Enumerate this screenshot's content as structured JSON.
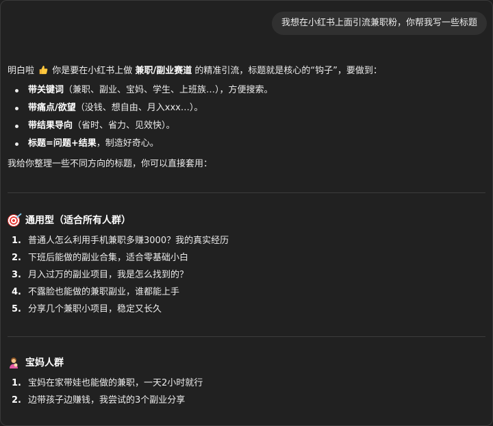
{
  "user_message": "我想在小红书上面引流兼职粉，你帮我写一些标题",
  "assistant": {
    "intro": {
      "p1": "明白啦",
      "p2": "你是要在小红书上做",
      "p3": "兼职/副业赛道",
      "p4": "的精准引流，标题就是核心的“钩子”，要做到："
    },
    "bullets": [
      {
        "bold": "带关键词",
        "rest": "（兼职、副业、宝妈、学生、上班族…），方便搜索。"
      },
      {
        "bold": "带痛点/欲望",
        "rest": "（没钱、想自由、月入xxx…）。"
      },
      {
        "bold": "带结果导向",
        "rest": "（省时、省力、见效快）。"
      },
      {
        "bold": "标题=问题+结果",
        "rest": "，制造好奇心。"
      }
    ],
    "intro2": "我给你整理一些不同方向的标题，你可以直接套用："
  },
  "sections": [
    {
      "icon": "target-icon",
      "title": "通用型（适合所有人群）",
      "items": [
        {
          "num": "1.",
          "text": "普通人怎么利用手机兼职多赚3000？我的真实经历"
        },
        {
          "num": "2.",
          "text": "下班后能做的副业合集，适合零基础小白"
        },
        {
          "num": "3.",
          "text": "月入过万的副业项目，我是怎么找到的？"
        },
        {
          "num": "4.",
          "text": "不露脸也能做的兼职副业，谁都能上手"
        },
        {
          "num": "5.",
          "text": "分享几个兼职小项目，稳定又长久"
        }
      ]
    },
    {
      "icon": "mom-icon",
      "title": "宝妈人群",
      "items": [
        {
          "num": "1.",
          "text": "宝妈在家带娃也能做的兼职，一天2小时就行"
        },
        {
          "num": "2.",
          "text": "边带孩子边赚钱，我尝试的3个副业分享"
        }
      ]
    }
  ]
}
